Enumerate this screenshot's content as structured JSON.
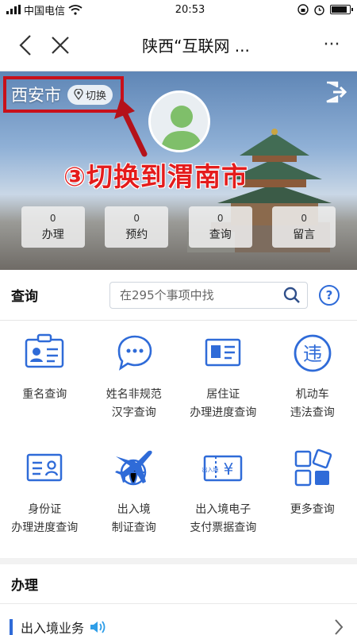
{
  "status": {
    "carrier": "中国电信",
    "time": "20:53"
  },
  "nav": {
    "title": "陕西“互联网 ...",
    "more": "···"
  },
  "hero": {
    "city": "西安市",
    "switch_label": "切换",
    "annotation": "③切换到渭南市",
    "stats": [
      {
        "count": "0",
        "label": "办理"
      },
      {
        "count": "0",
        "label": "预约"
      },
      {
        "count": "0",
        "label": "查询"
      },
      {
        "count": "0",
        "label": "留言"
      }
    ]
  },
  "query": {
    "title": "查询",
    "placeholder": "在295个事项中找",
    "help": "?"
  },
  "tiles": [
    {
      "icon": "id-card-icon",
      "label": "重名查询"
    },
    {
      "icon": "chat-bubbles-icon",
      "label": "姓名非规范\n汉字查询"
    },
    {
      "icon": "residence-card-icon",
      "label": "居住证\n办理进度查询"
    },
    {
      "icon": "violation-icon",
      "label": "机动车\n违法查询"
    },
    {
      "icon": "identity-card-icon",
      "label": "身份证\n办理进度查询"
    },
    {
      "icon": "airplane-globe-icon",
      "label": "出入境\n制证查询"
    },
    {
      "icon": "ticket-icon",
      "label": "出入境电子\n支付票据查询"
    },
    {
      "icon": "more-grid-icon",
      "label": "更多查询"
    }
  ],
  "handle": {
    "title": "办理"
  },
  "list": {
    "item_label": "出入境业务"
  },
  "colors": {
    "accent": "#2f6bd8",
    "annotation": "#e41c1c"
  }
}
